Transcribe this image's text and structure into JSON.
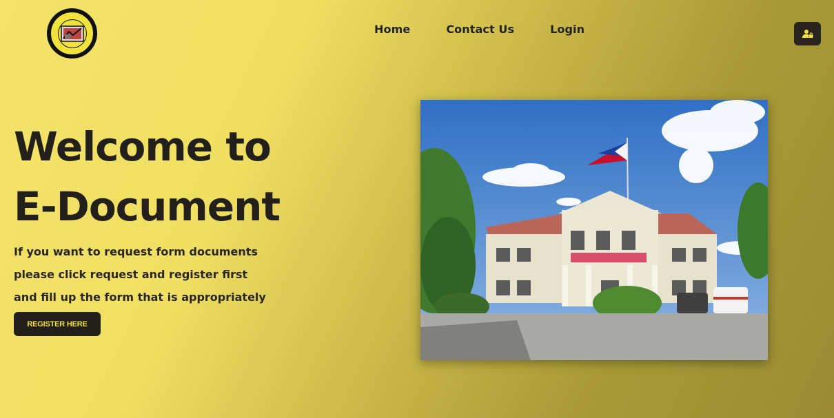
{
  "header": {
    "logo_icon": "municipal-civil-registrar-seal",
    "nav": {
      "home": "Home",
      "contact": "Contact Us",
      "login": "Login"
    },
    "user_button_icon": "user-lock-icon"
  },
  "hero": {
    "title_line1": "Welcome to",
    "title_line2": "E-Document",
    "text_line1": "If you want to request form documents",
    "text_line2": "please click request and register first",
    "text_line3": "and fill up the form that is appropriately",
    "register_label": "REGISTER HERE"
  },
  "colors": {
    "accent": "#f2e23d",
    "dark": "#231f1b"
  }
}
